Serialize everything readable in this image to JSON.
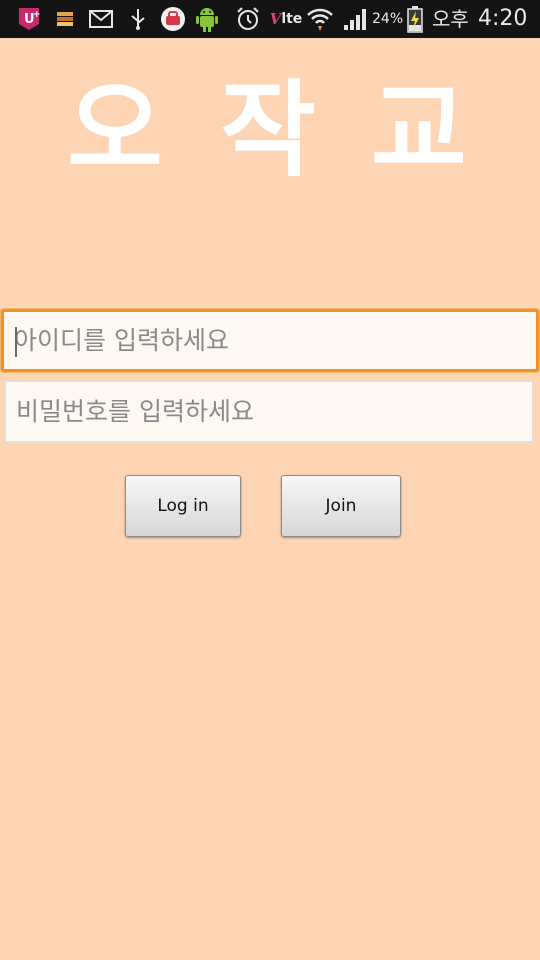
{
  "status_bar": {
    "battery_percent": "24%",
    "ampm": "오후",
    "time": "4:20",
    "network_label": "lte",
    "network_prefix": "V",
    "icons": [
      "uplus-icon",
      "stack-icon",
      "mail-icon",
      "usb-icon",
      "app-icon",
      "android-icon",
      "alarm-icon",
      "volte-icon",
      "wifi-icon",
      "signal-icon",
      "battery-charging-icon"
    ]
  },
  "app": {
    "title_chars": [
      "오",
      "작",
      "교"
    ]
  },
  "form": {
    "id_field": {
      "placeholder": "아이디를 입력하세요",
      "value": ""
    },
    "password_field": {
      "placeholder": "비밀번호를 입력하세요",
      "value": ""
    },
    "login_label": "Log in",
    "join_label": "Join"
  },
  "colors": {
    "background": "#fdd5b5",
    "focus_border": "#f0922a",
    "status_bar": "#141414"
  }
}
